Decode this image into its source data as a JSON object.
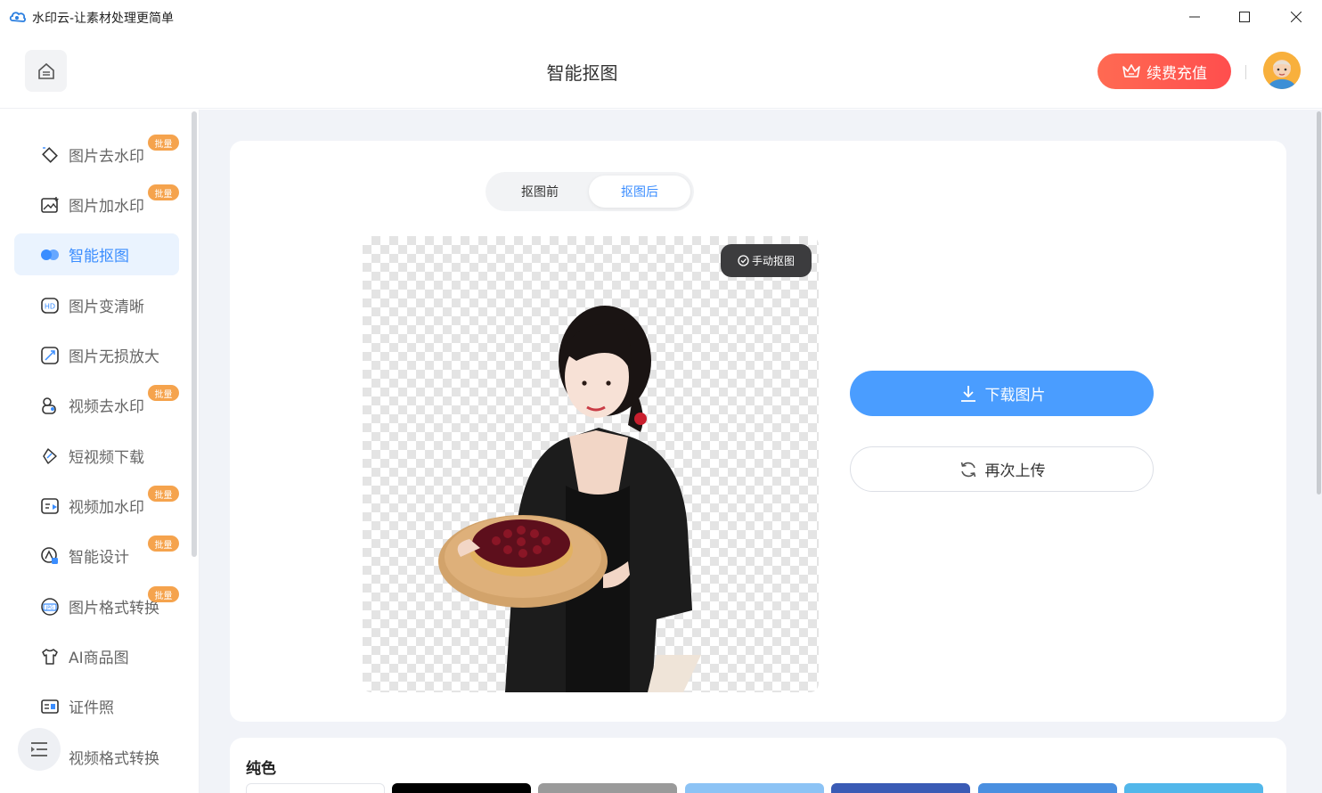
{
  "window": {
    "title": "水印云-让素材处理更简单",
    "controls": [
      "minimize",
      "maximize",
      "close"
    ]
  },
  "header": {
    "title": "智能抠图",
    "renew_label": "续费充值",
    "home_icon": "home-icon",
    "accent": "#ff5a4e"
  },
  "sidebar": {
    "items": [
      {
        "label": "图片去水印",
        "icon": "eraser-icon",
        "badge": "批量",
        "active": false
      },
      {
        "label": "图片加水印",
        "icon": "image-add-icon",
        "badge": "批量",
        "active": false
      },
      {
        "label": "智能抠图",
        "icon": "cutout-icon",
        "badge": "",
        "active": true
      },
      {
        "label": "图片变清晰",
        "icon": "hd-icon",
        "badge": "",
        "active": false
      },
      {
        "label": "图片无损放大",
        "icon": "enlarge-icon",
        "badge": "",
        "active": false
      },
      {
        "label": "视频去水印",
        "icon": "video-eraser-icon",
        "badge": "批量",
        "active": false
      },
      {
        "label": "短视频下载",
        "icon": "link-icon",
        "badge": "",
        "active": false
      },
      {
        "label": "视频加水印",
        "icon": "video-add-icon",
        "badge": "批量",
        "active": false
      },
      {
        "label": "智能设计",
        "icon": "design-icon",
        "badge": "批量",
        "active": false
      },
      {
        "label": "图片格式转换",
        "icon": "jpg-icon",
        "badge": "批量",
        "active": false
      },
      {
        "label": "AI商品图",
        "icon": "tshirt-icon",
        "badge": "",
        "active": false
      },
      {
        "label": "证件照",
        "icon": "id-card-icon",
        "badge": "",
        "active": false
      },
      {
        "label": "视频格式转换",
        "icon": "video-convert-icon",
        "badge": "",
        "active": false
      }
    ],
    "active_color": "#3a8dff"
  },
  "main": {
    "toggle": {
      "before": "抠图前",
      "after": "抠图后",
      "selected": "after"
    },
    "manual_label": "手动抠图",
    "download_label": "下载图片",
    "reupload_label": "再次上传",
    "download_color": "#4a9dff",
    "color_section": {
      "title": "纯色",
      "swatches": [
        "#ffffff",
        "#000000",
        "#9a9a9a",
        "#8cc3f5",
        "#3a5bb5",
        "#4a8fe0",
        "#52b7ea"
      ]
    }
  }
}
